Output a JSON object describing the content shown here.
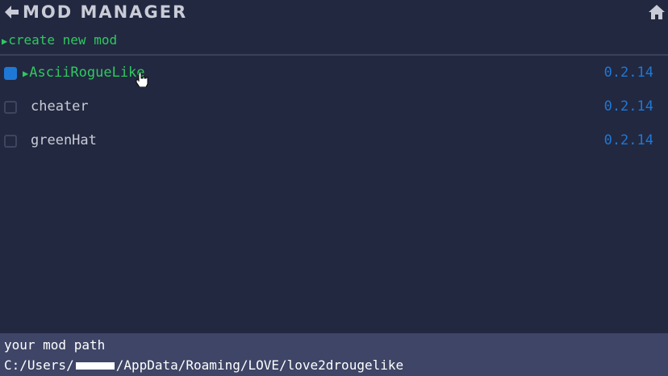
{
  "header": {
    "title": "MOD MANAGER",
    "back_icon": "back-arrow-icon",
    "home_icon": "home-icon"
  },
  "actions": {
    "create_label": "create new mod",
    "create_marker": "▶"
  },
  "mods": [
    {
      "name": "AsciiRogueLike",
      "version": "0.2.14",
      "checked": true,
      "selected": true,
      "marker": "▶"
    },
    {
      "name": "cheater",
      "version": "0.2.14",
      "checked": false,
      "selected": false
    },
    {
      "name": "greenHat",
      "version": "0.2.14",
      "checked": false,
      "selected": false
    }
  ],
  "footer": {
    "label": "your mod path",
    "path_prefix": "C:/Users/",
    "path_suffix": "/AppData/Roaming/LOVE/love2drougelike"
  },
  "colors": {
    "background": "#222840",
    "accent_green": "#2fc95f",
    "version_blue": "#1e78d6",
    "footer_bg": "#3e4566"
  }
}
